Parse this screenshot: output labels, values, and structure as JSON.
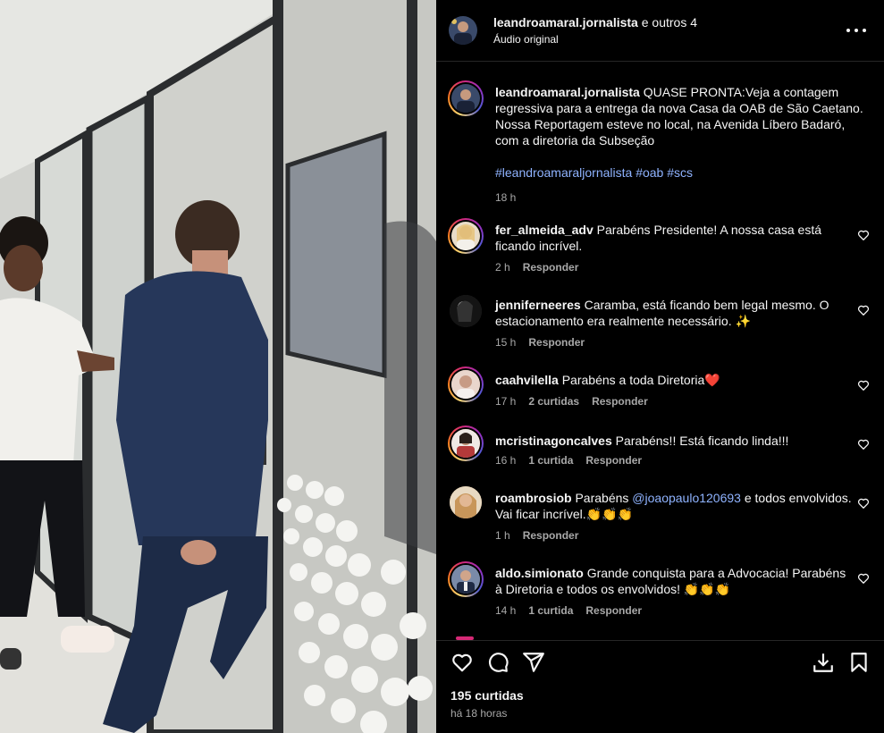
{
  "post": {
    "author": "leandroamaral.jornalista",
    "others": "e outros 4",
    "audio": "Áudio original",
    "caption_user": "leandroamaral.jornalista",
    "caption_text": "QUASE PRONTA:Veja a contagem regressiva para a entrega da nova Casa da OAB de São Caetano. Nossa Reportagem esteve no local, na Avenida Líbero Badaró, com a diretoria da Subseção",
    "hashtags": "#leandroamaraljornalista #oab #scs",
    "caption_time": "18 h"
  },
  "comments": [
    {
      "user": "fer_almeida_adv",
      "text": "Parabéns Presidente! A nossa casa está ficando incrível.",
      "time": "2 h",
      "likes": "",
      "reply": "Responder",
      "ring": true,
      "avatar_color": "#e8dcc8"
    },
    {
      "user": "jenniferneeres",
      "text": "Caramba, está ficando bem legal mesmo. O estacionamento era realmente necessário. ✨",
      "time": "15 h",
      "likes": "",
      "reply": "Responder",
      "ring": false,
      "avatar_color": "#2a2a2a"
    },
    {
      "user": "caahvilella",
      "text": "Parabéns a toda Diretoria❤️",
      "time": "17 h",
      "likes": "2 curtidas",
      "reply": "Responder",
      "ring": true,
      "avatar_color": "#d9b9a8"
    },
    {
      "user": "mcristinagoncalves",
      "text": "Parabéns!! Está ficando linda!!!",
      "time": "16 h",
      "likes": "1 curtida",
      "reply": "Responder",
      "ring": true,
      "avatar_color": "#b43a3a"
    },
    {
      "user": "roambrosiob",
      "text_before": "Parabéns ",
      "mention": "@joaopaulo120693",
      "text_after": " e todos envolvidos. Vai ficar incrível.👏👏👏",
      "time": "1 h",
      "likes": "",
      "reply": "Responder",
      "ring": false,
      "avatar_color": "#c8965a"
    },
    {
      "user": "aldo.simionato",
      "text": "Grande conquista para a Advocacia! Parabéns à Diretoria e todos os envolvidos! 👏👏👏",
      "time": "14 h",
      "likes": "1 curtida",
      "reply": "Responder",
      "ring": true,
      "avatar_color": "#5a6a88"
    }
  ],
  "footer": {
    "likes": "195 curtidas",
    "ago": "há 18 horas"
  },
  "icons": [
    "heart-icon",
    "comment-icon",
    "share-icon",
    "download-icon",
    "bookmark-icon",
    "more-icon"
  ]
}
